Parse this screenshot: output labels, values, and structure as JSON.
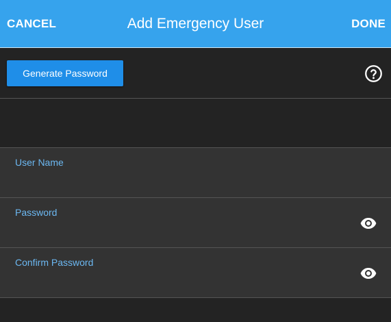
{
  "header": {
    "cancel_label": "CANCEL",
    "title": "Add Emergency User",
    "done_label": "DONE",
    "background_color": "#36a3ed"
  },
  "toolbar": {
    "generate_label": "Generate Password",
    "help_icon": "help-circle-icon"
  },
  "form": {
    "fields": [
      {
        "label": "User Name",
        "value": "",
        "type": "text"
      },
      {
        "label": "Password",
        "value": "",
        "type": "password",
        "icon": "eye-icon"
      },
      {
        "label": "Confirm Password",
        "value": "",
        "type": "password",
        "icon": "eye-icon"
      }
    ]
  },
  "colors": {
    "accent": "#1f8ee8",
    "label": "#6cb8f2",
    "background": "#232323",
    "field_background": "#333333"
  }
}
